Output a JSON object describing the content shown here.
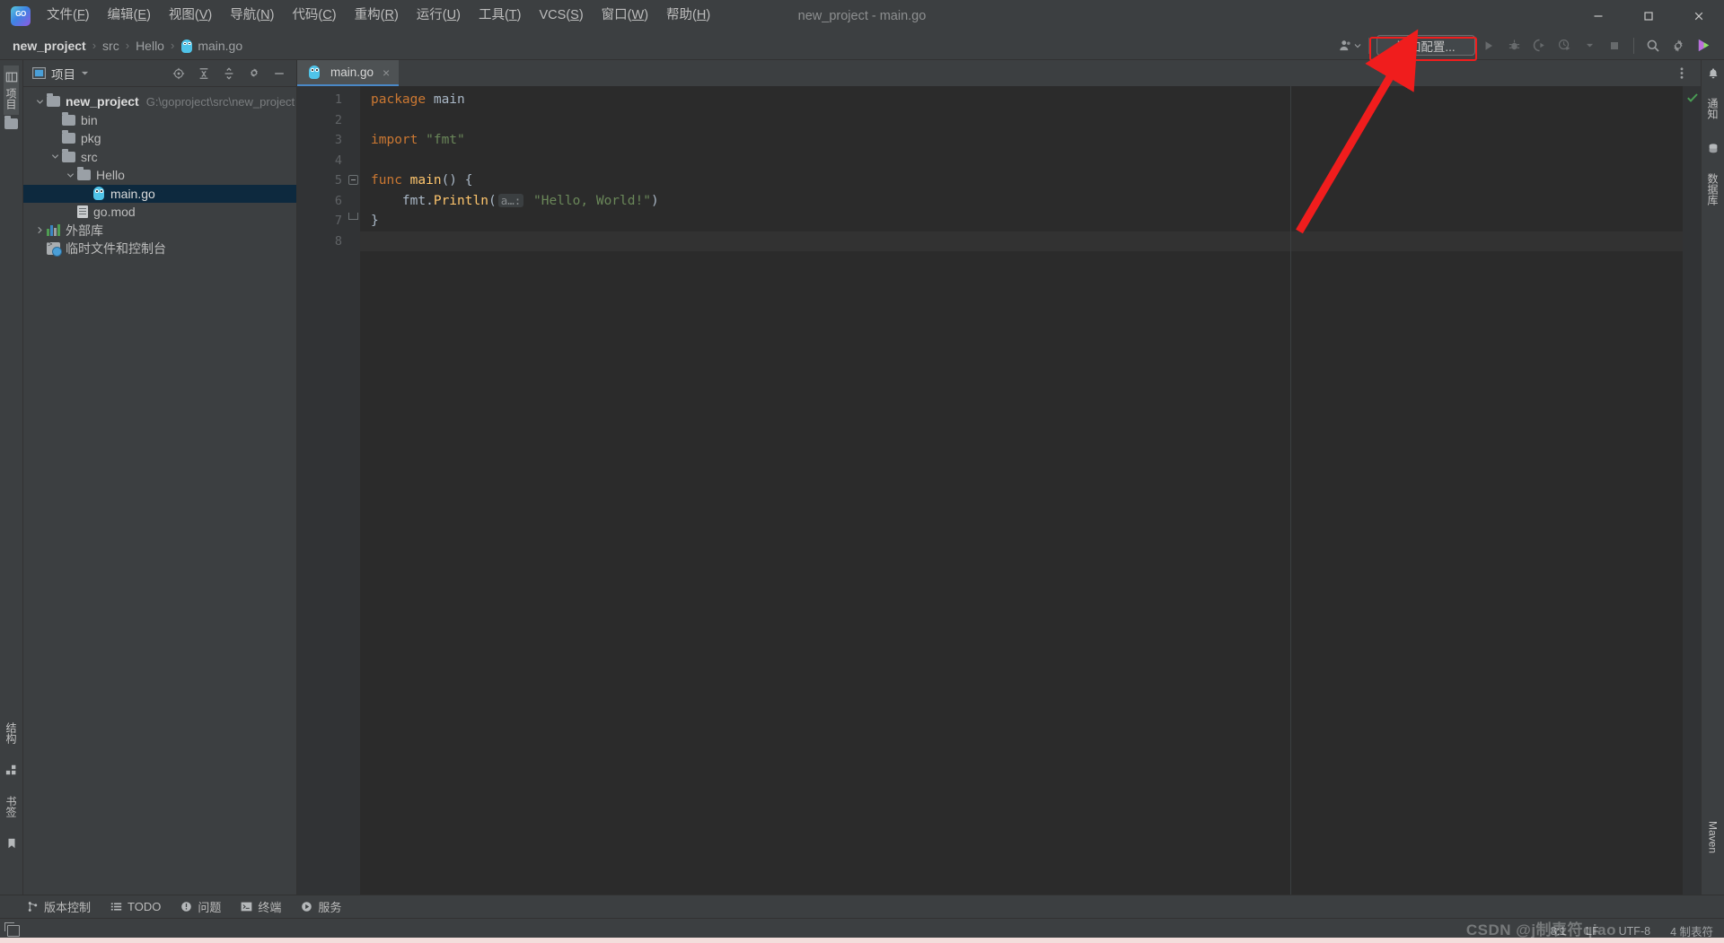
{
  "window": {
    "title": "new_project - main.go",
    "logo_icon": "goland-logo-icon",
    "minimize_icon": "minimize-icon",
    "maximize_icon": "maximize-icon",
    "close_icon": "close-icon"
  },
  "menubar": {
    "items": [
      {
        "label": "文件(F)",
        "mnemonic": "F",
        "name": "menu-file"
      },
      {
        "label": "编辑(E)",
        "mnemonic": "E",
        "name": "menu-edit"
      },
      {
        "label": "视图(V)",
        "mnemonic": "V",
        "name": "menu-view"
      },
      {
        "label": "导航(N)",
        "mnemonic": "N",
        "name": "menu-navigate"
      },
      {
        "label": "代码(C)",
        "mnemonic": "C",
        "name": "menu-code"
      },
      {
        "label": "重构(R)",
        "mnemonic": "R",
        "name": "menu-refactor"
      },
      {
        "label": "运行(U)",
        "mnemonic": "U",
        "name": "menu-run"
      },
      {
        "label": "工具(T)",
        "mnemonic": "T",
        "name": "menu-tools"
      },
      {
        "label": "VCS(S)",
        "mnemonic": "S",
        "name": "menu-vcs"
      },
      {
        "label": "窗口(W)",
        "mnemonic": "W",
        "name": "menu-window"
      },
      {
        "label": "帮助(H)",
        "mnemonic": "H",
        "name": "menu-help"
      }
    ]
  },
  "breadcrumb": {
    "separator": "›",
    "items": [
      {
        "label": "new_project",
        "strong": true,
        "icon": ""
      },
      {
        "label": "src",
        "strong": false,
        "icon": ""
      },
      {
        "label": "Hello",
        "strong": false,
        "icon": ""
      },
      {
        "label": "main.go",
        "strong": false,
        "icon": "go-file-icon"
      }
    ]
  },
  "navbar_right": {
    "account_icon": "user-account-icon",
    "account_dropdown_icon": "chevron-down-icon",
    "add_configuration_label": "添加配置...",
    "run_icon": "run-icon",
    "debug_icon": "debug-icon",
    "run_coverage_icon": "run-with-coverage-icon",
    "profile_icon": "profiler-icon",
    "profile_dropdown_icon": "chevron-down-icon",
    "stop_icon": "stop-icon",
    "search_icon": "search-everywhere-icon",
    "settings_icon": "gear-icon",
    "updates_icon": "ide-update-icon"
  },
  "left_strip": {
    "project_label": "项目",
    "project_icon": "project-tool-window-icon",
    "folder_icon": "folder-icon",
    "structure_label": "结构",
    "structure_icon": "structure-icon",
    "bookmarks_label": "书签",
    "bookmarks_icon": "bookmark-icon"
  },
  "project_panel": {
    "title": "项目",
    "title_icon": "project-icon",
    "dropdown_icon": "chevron-down-icon",
    "locate_icon": "scroll-from-source-icon",
    "expand_icon": "expand-all-icon",
    "collapse_icon": "collapse-all-icon",
    "settings_icon": "gear-icon",
    "hide_icon": "hide-icon",
    "tree": [
      {
        "label": "new_project",
        "sub": "G:\\goproject\\src\\new_project",
        "depth": 0,
        "arrow": "expanded",
        "icon": "folder-icon",
        "strong": true,
        "selected": false,
        "name": "tree-node-new-project"
      },
      {
        "label": "bin",
        "sub": "",
        "depth": 1,
        "arrow": "none",
        "icon": "folder-icon",
        "strong": false,
        "selected": false,
        "name": "tree-node-bin"
      },
      {
        "label": "pkg",
        "sub": "",
        "depth": 1,
        "arrow": "none",
        "icon": "folder-icon",
        "strong": false,
        "selected": false,
        "name": "tree-node-pkg"
      },
      {
        "label": "src",
        "sub": "",
        "depth": 1,
        "arrow": "expanded",
        "icon": "folder-icon",
        "strong": false,
        "selected": false,
        "name": "tree-node-src"
      },
      {
        "label": "Hello",
        "sub": "",
        "depth": 2,
        "arrow": "expanded",
        "icon": "folder-icon",
        "strong": false,
        "selected": false,
        "name": "tree-node-hello"
      },
      {
        "label": "main.go",
        "sub": "",
        "depth": 3,
        "arrow": "none",
        "icon": "go-file-icon",
        "strong": false,
        "selected": true,
        "name": "tree-node-main-go"
      },
      {
        "label": "go.mod",
        "sub": "",
        "depth": 2,
        "arrow": "none",
        "icon": "doc-icon",
        "strong": false,
        "selected": false,
        "name": "tree-node-go-mod"
      },
      {
        "label": "外部库",
        "sub": "",
        "depth": 0,
        "arrow": "collapsed",
        "icon": "external-libraries-icon",
        "strong": false,
        "selected": false,
        "name": "tree-node-external-libraries"
      },
      {
        "label": "临时文件和控制台",
        "sub": "",
        "depth": 0,
        "arrow": "none",
        "icon": "scratches-icon",
        "strong": false,
        "selected": false,
        "name": "tree-node-scratches-consoles"
      }
    ]
  },
  "editor": {
    "tabs": [
      {
        "label": "main.go",
        "icon": "go-file-icon",
        "close_icon": "close-icon",
        "active": true
      }
    ],
    "options_icon": "more-options-icon",
    "inspection_status_icon": "inspections-ok-check-icon",
    "lines": [
      {
        "num": "1",
        "run_marker": false,
        "fold": "none",
        "current": false,
        "tokens": [
          {
            "t": "package ",
            "c": "kw"
          },
          {
            "t": "main",
            "c": "pkgname"
          }
        ]
      },
      {
        "num": "2",
        "run_marker": false,
        "fold": "none",
        "current": false,
        "tokens": []
      },
      {
        "num": "3",
        "run_marker": false,
        "fold": "none",
        "current": false,
        "tokens": [
          {
            "t": "import ",
            "c": "kw"
          },
          {
            "t": "\"fmt\"",
            "c": "str"
          }
        ]
      },
      {
        "num": "4",
        "run_marker": false,
        "fold": "none",
        "current": false,
        "tokens": []
      },
      {
        "num": "5",
        "run_marker": true,
        "fold": "minus",
        "current": false,
        "tokens": [
          {
            "t": "func ",
            "c": "kw"
          },
          {
            "t": "main",
            "c": "fn"
          },
          {
            "t": "() {",
            "c": "plain"
          }
        ]
      },
      {
        "num": "6",
        "run_marker": false,
        "fold": "none",
        "current": false,
        "tokens": [
          {
            "t": "    fmt.",
            "c": "plain"
          },
          {
            "t": "Println",
            "c": "fn"
          },
          {
            "t": "(",
            "c": "plain"
          },
          {
            "t": "a…:",
            "c": "hint"
          },
          {
            "t": " \"Hello, World!\"",
            "c": "str"
          },
          {
            "t": ")",
            "c": "plain"
          }
        ]
      },
      {
        "num": "7",
        "run_marker": false,
        "fold": "end",
        "current": false,
        "tokens": [
          {
            "t": "}",
            "c": "plain"
          }
        ]
      },
      {
        "num": "8",
        "run_marker": false,
        "fold": "none",
        "current": true,
        "tokens": []
      }
    ]
  },
  "right_strip": {
    "notifications_label": "通知",
    "notifications_icon": "bell-icon",
    "database_label": "数据库",
    "database_icon": "database-icon",
    "maven_label": "Maven",
    "maven_icon": "maven-icon"
  },
  "tool_window_bar": {
    "items": [
      {
        "label": "版本控制",
        "icon": "version-control-icon",
        "name": "toolwindow-version-control"
      },
      {
        "label": "TODO",
        "icon": "todo-icon",
        "name": "toolwindow-todo"
      },
      {
        "label": "问题",
        "icon": "problems-icon",
        "name": "toolwindow-problems"
      },
      {
        "label": "终端",
        "icon": "terminal-icon",
        "name": "toolwindow-terminal"
      },
      {
        "label": "服务",
        "icon": "services-icon",
        "name": "toolwindow-services"
      }
    ]
  },
  "statusbar": {
    "window_icon": "tool-windows-icon",
    "caret_position": "8:1",
    "line_separator": "LF",
    "encoding": "UTF-8",
    "indent": "4 制表符"
  },
  "watermark": {
    "text": "CSDN @j制表符qiao"
  },
  "annotation": {
    "highlight_target": "添加配置...",
    "arrow_color": "#f01d1d"
  },
  "colors": {
    "accent_tab_underline": "#4a88c7",
    "selection_bg": "#0d293e",
    "keyword": "#cc7832",
    "string": "#6a8759",
    "function": "#ffc66d",
    "plain_code": "#a9b7c6",
    "editor_bg": "#2b2b2b",
    "panel_bg": "#3c3f41"
  }
}
